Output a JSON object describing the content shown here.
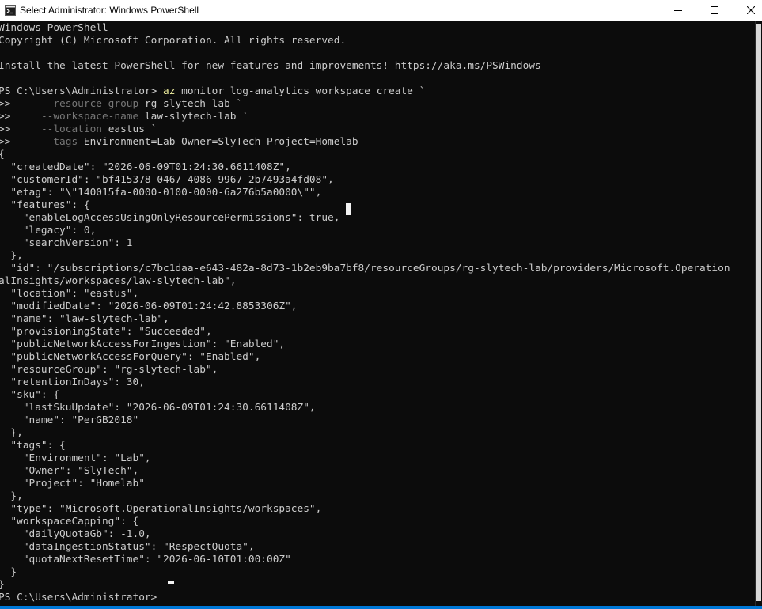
{
  "window": {
    "title": "Select Administrator: Windows PowerShell",
    "icon": "powershell-icon",
    "controls": {
      "minimize": "minimize-icon",
      "maximize": "maximize-icon",
      "close": "close-icon"
    }
  },
  "colors": {
    "background": "#0c0c0c",
    "text": "#cccccc",
    "command": "#f2f2a0",
    "parameter": "#767676",
    "accent": "#0078d7"
  },
  "console": {
    "lines": [
      [
        {
          "t": "Windows PowerShell",
          "c": "text"
        }
      ],
      [
        {
          "t": "Copyright (C) Microsoft Corporation. All rights reserved.",
          "c": "text"
        }
      ],
      [
        {
          "t": "",
          "c": "text"
        }
      ],
      [
        {
          "t": "Install the latest PowerShell for new features and improvements! https://aka.ms/PSWindows",
          "c": "text"
        }
      ],
      [
        {
          "t": "",
          "c": "text"
        }
      ],
      [
        {
          "t": "PS C:\\Users\\Administrator> ",
          "c": "text"
        },
        {
          "t": "az",
          "c": "cmd"
        },
        {
          "t": " monitor log-analytics workspace create `",
          "c": "text"
        }
      ],
      [
        {
          "t": ">>     ",
          "c": "text"
        },
        {
          "t": "--resource-group",
          "c": "dim"
        },
        {
          "t": " rg-slytech-lab `",
          "c": "text"
        }
      ],
      [
        {
          "t": ">>     ",
          "c": "text"
        },
        {
          "t": "--workspace-name",
          "c": "dim"
        },
        {
          "t": " law-slytech-lab `",
          "c": "text"
        }
      ],
      [
        {
          "t": ">>     ",
          "c": "text"
        },
        {
          "t": "--location",
          "c": "dim"
        },
        {
          "t": " eastus `",
          "c": "text"
        }
      ],
      [
        {
          "t": ">>     ",
          "c": "text"
        },
        {
          "t": "--tags",
          "c": "dim"
        },
        {
          "t": " Environment=Lab Owner=SlyTech Project=Homelab",
          "c": "text"
        }
      ],
      [
        {
          "t": "{",
          "c": "text"
        }
      ],
      [
        {
          "t": "  \"createdDate\": \"2026-06-09T01:24:30.6611408Z\",",
          "c": "text"
        }
      ],
      [
        {
          "t": "  \"customerId\": \"bf415378-0467-4086-9967-2b7493a4fd08\",",
          "c": "text"
        }
      ],
      [
        {
          "t": "  \"etag\": \"\\\"140015fa-0000-0100-0000-6a276b5a0000\\\"\",",
          "c": "text"
        }
      ],
      [
        {
          "t": "  \"features\": {",
          "c": "text"
        }
      ],
      [
        {
          "t": "    \"enableLogAccessUsingOnlyResourcePermissions\": true,",
          "c": "text"
        }
      ],
      [
        {
          "t": "    \"legacy\": 0,",
          "c": "text"
        }
      ],
      [
        {
          "t": "    \"searchVersion\": 1",
          "c": "text"
        }
      ],
      [
        {
          "t": "  },",
          "c": "text"
        }
      ],
      [
        {
          "t": "  \"id\": \"/subscriptions/c7bc1daa-e643-482a-8d73-1b2eb9ba7bf8/resourceGroups/rg-slytech-lab/providers/Microsoft.Operation",
          "c": "text"
        }
      ],
      [
        {
          "t": "alInsights/workspaces/law-slytech-lab\",",
          "c": "text"
        }
      ],
      [
        {
          "t": "  \"location\": \"eastus\",",
          "c": "text"
        }
      ],
      [
        {
          "t": "  \"modifiedDate\": \"2026-06-09T01:24:42.8853306Z\",",
          "c": "text"
        }
      ],
      [
        {
          "t": "  \"name\": \"law-slytech-lab\",",
          "c": "text"
        }
      ],
      [
        {
          "t": "  \"provisioningState\": \"Succeeded\",",
          "c": "text"
        }
      ],
      [
        {
          "t": "  \"publicNetworkAccessForIngestion\": \"Enabled\",",
          "c": "text"
        }
      ],
      [
        {
          "t": "  \"publicNetworkAccessForQuery\": \"Enabled\",",
          "c": "text"
        }
      ],
      [
        {
          "t": "  \"resourceGroup\": \"rg-slytech-lab\",",
          "c": "text"
        }
      ],
      [
        {
          "t": "  \"retentionInDays\": 30,",
          "c": "text"
        }
      ],
      [
        {
          "t": "  \"sku\": {",
          "c": "text"
        }
      ],
      [
        {
          "t": "    \"lastSkuUpdate\": \"2026-06-09T01:24:30.6611408Z\",",
          "c": "text"
        }
      ],
      [
        {
          "t": "    \"name\": \"PerGB2018\"",
          "c": "text"
        }
      ],
      [
        {
          "t": "  },",
          "c": "text"
        }
      ],
      [
        {
          "t": "  \"tags\": {",
          "c": "text"
        }
      ],
      [
        {
          "t": "    \"Environment\": \"Lab\",",
          "c": "text"
        }
      ],
      [
        {
          "t": "    \"Owner\": \"SlyTech\",",
          "c": "text"
        }
      ],
      [
        {
          "t": "    \"Project\": \"Homelab\"",
          "c": "text"
        }
      ],
      [
        {
          "t": "  },",
          "c": "text"
        }
      ],
      [
        {
          "t": "  \"type\": \"Microsoft.OperationalInsights/workspaces\",",
          "c": "text"
        }
      ],
      [
        {
          "t": "  \"workspaceCapping\": {",
          "c": "text"
        }
      ],
      [
        {
          "t": "    \"dailyQuotaGb\": -1.0,",
          "c": "text"
        }
      ],
      [
        {
          "t": "    \"dataIngestionStatus\": \"RespectQuota\",",
          "c": "text"
        }
      ],
      [
        {
          "t": "    \"quotaNextResetTime\": \"2026-06-10T01:00:00Z\"",
          "c": "text"
        }
      ],
      [
        {
          "t": "  }",
          "c": "text"
        }
      ],
      [
        {
          "t": "}",
          "c": "text"
        }
      ],
      [
        {
          "t": "PS C:\\Users\\Administrator> ",
          "c": "text"
        }
      ]
    ]
  }
}
